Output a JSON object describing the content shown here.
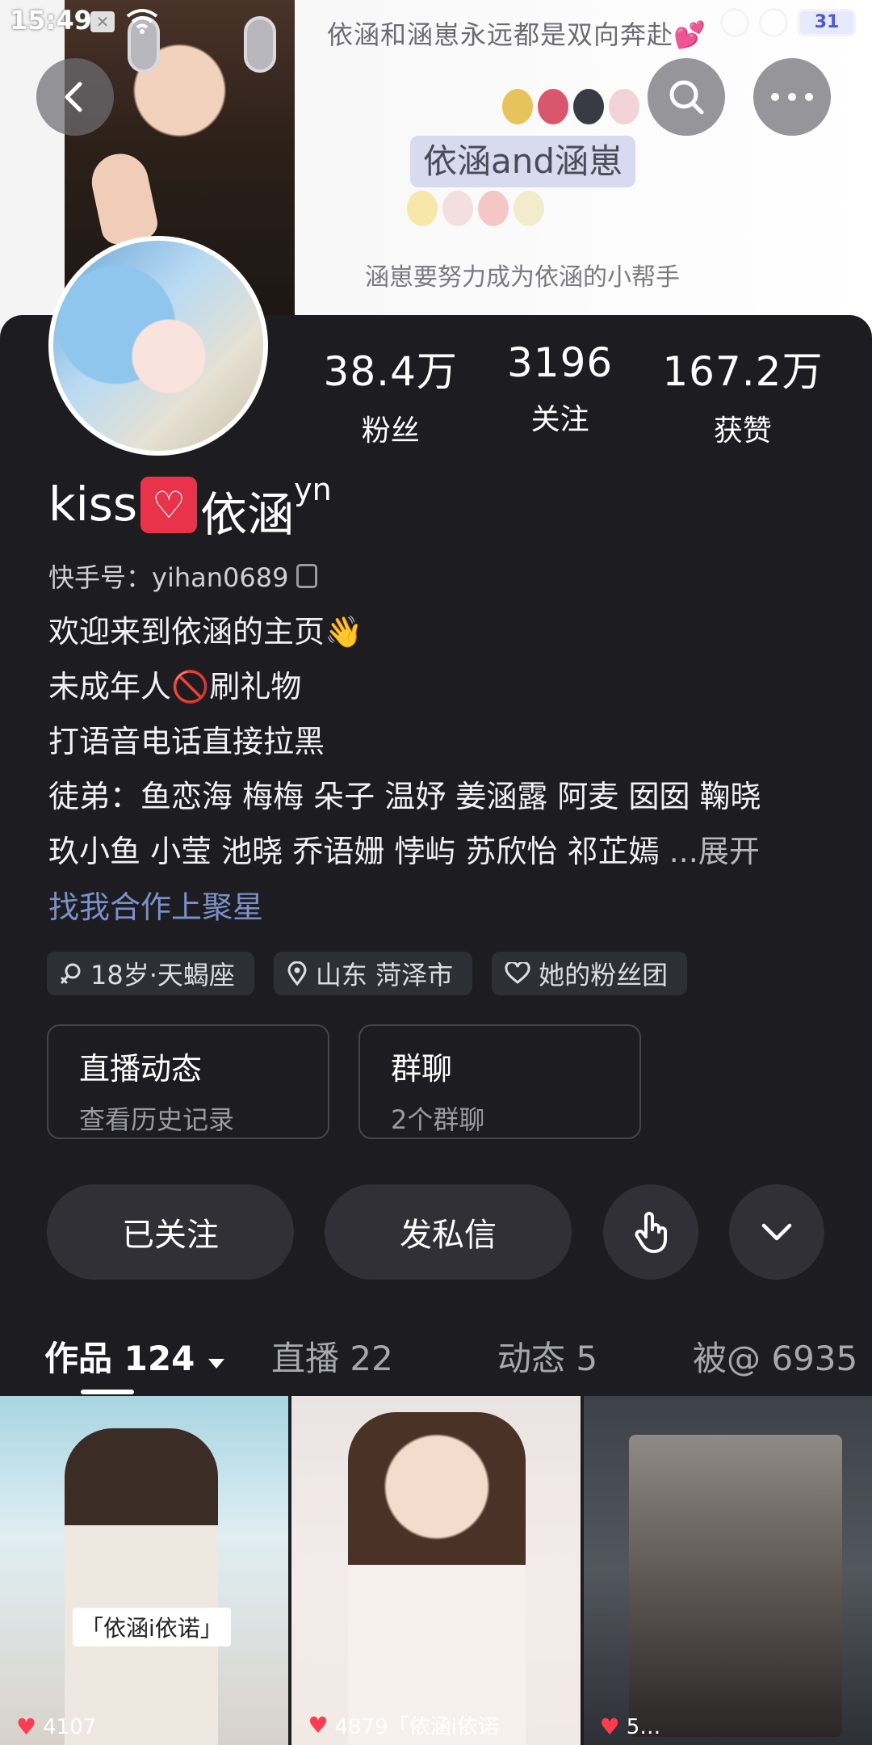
{
  "status_bar": {
    "time": "15:49",
    "battery": "31"
  },
  "banner": {
    "top_text": "依涵和涵崽永远都是双向奔赴💕",
    "label": "依涵and涵崽",
    "subtitle": "涵崽要努力成为依涵的小帮手"
  },
  "profile": {
    "stats": [
      {
        "value": "38.4万",
        "label": "粉丝"
      },
      {
        "value": "3196",
        "label": "关注"
      },
      {
        "value": "167.2万",
        "label": "获赞"
      }
    ],
    "name_prefix": "kiss",
    "name_heart": "♡",
    "name_main": "依涵",
    "name_sup": "yn",
    "uid": "快手号：yihan0689",
    "bio": [
      "欢迎来到依涵的主页👋",
      "未成年人🚫刷礼物",
      "打语音电话直接拉黑",
      "徒弟：鱼恋海 梅梅 朵子 温妤 姜涵露 阿麦 囡囡 鞠晓",
      "玖小鱼 小莹 池晓 乔语姗 悖屿 苏欣怡 祁芷嫣"
    ],
    "expand_label": "...展开",
    "link_text": "找我合作上聚星",
    "tags": [
      "18岁·天蝎座",
      "山东 菏泽市",
      "她的粉丝团"
    ]
  },
  "info_boxes": {
    "live": {
      "title": "直播动态",
      "subtitle": "查看历史记录"
    },
    "group": {
      "title": "群聊",
      "subtitle": "2个群聊"
    }
  },
  "actions": {
    "follow": "已关注",
    "message": "发私信"
  },
  "tabs": [
    {
      "label": "作品 124"
    },
    {
      "label": "直播 22"
    },
    {
      "label": "动态 5"
    },
    {
      "label": "被@ 6935"
    }
  ],
  "videos": [
    {
      "caption": "「依涵i依诺」",
      "likes": "4107"
    },
    {
      "caption": "",
      "likes": "4879「依涵i依诺"
    },
    {
      "caption": "",
      "likes": "5…"
    }
  ],
  "colors": {
    "background": "#1c1c21",
    "accent_link": "#7a90c9",
    "heart": "#e8334a"
  }
}
